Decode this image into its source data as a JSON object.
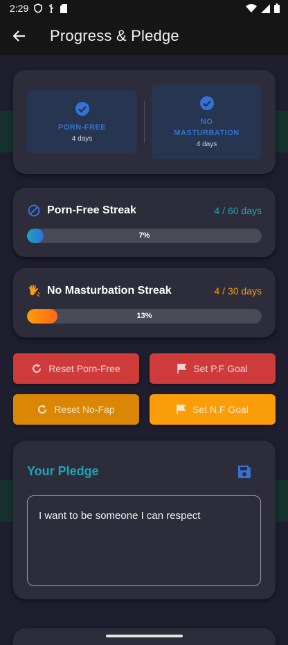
{
  "status_bar": {
    "time": "2:29"
  },
  "app_bar": {
    "title": "Progress & Pledge"
  },
  "summary": {
    "porn_free": {
      "label": "PORN-FREE",
      "days": "4 days"
    },
    "no_masturbation": {
      "label_line1": "NO",
      "label_line2": "MASTURBATION",
      "days": "4 days"
    }
  },
  "streaks": {
    "porn_free": {
      "title": "Porn-Free Streak",
      "count": "4 / 60 days",
      "progress_label": "7%",
      "progress": 0.07,
      "color": "#1ca6b5",
      "icon": "block-icon"
    },
    "no_masturbation": {
      "title": "No Masturbation Streak",
      "count": "4 / 30 days",
      "progress_label": "13%",
      "progress": 0.13,
      "color": "#fb9d08",
      "icon": "hand-icon"
    }
  },
  "actions": {
    "reset_pf": "Reset Porn-Free",
    "set_pf_goal": "Set P.F Goal",
    "reset_nf": "Reset No-Fap",
    "set_nf_goal": "Set N.F Goal"
  },
  "pledge": {
    "title": "Your Pledge",
    "text": "I want to be someone I can respect"
  },
  "colors": {
    "background": "#1e1e2e",
    "card": "#2c2c3a",
    "accent_teal": "#1ca6b5",
    "accent_blue": "#3572d8",
    "accent_red": "#cf3a3a",
    "accent_orange": "#fb9d08"
  }
}
